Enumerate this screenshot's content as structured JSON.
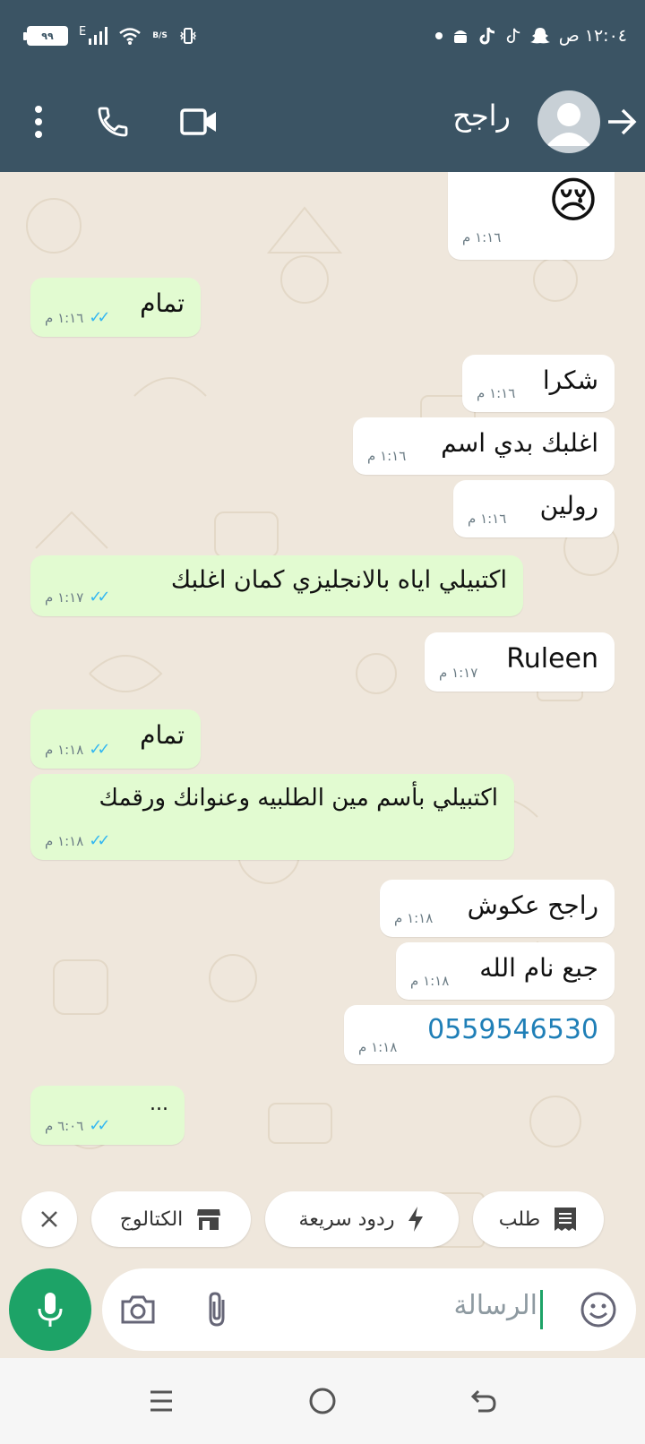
{
  "status": {
    "time": "١٢:٠٤ ص",
    "battery": "٩٩",
    "network": "E",
    "speed": "B/S"
  },
  "header": {
    "contact_name": "راجح"
  },
  "messages": [
    {
      "dir": "in",
      "text": "😢",
      "time": "١:١٦ م"
    },
    {
      "dir": "out",
      "text": "تمام",
      "time": "١:١٦ م"
    },
    {
      "dir": "in",
      "text": "شكرا",
      "time": "١:١٦ م"
    },
    {
      "dir": "in",
      "text": "اغلبك بدي اسم",
      "time": "١:١٦ م"
    },
    {
      "dir": "in",
      "text": "رولين",
      "time": "١:١٦ م"
    },
    {
      "dir": "out",
      "text": "اكتبيلي اياه بالانجليزي كمان اغلبك",
      "time": "١:١٧ م"
    },
    {
      "dir": "in",
      "text": "Ruleen",
      "time": "١:١٧ م"
    },
    {
      "dir": "out",
      "text": "تمام",
      "time": "١:١٨ م"
    },
    {
      "dir": "out",
      "text": "اكتبيلي بأسم مين الطلبيه وعنوانك ورقمك",
      "time": "١:١٨ م"
    },
    {
      "dir": "in",
      "text": "راجح عكوش",
      "time": "١:١٨ م"
    },
    {
      "dir": "in",
      "text": "جبع نام الله",
      "time": "١:١٨ م"
    },
    {
      "dir": "in",
      "text": "0559546530",
      "time": "١:١٨ م"
    },
    {
      "dir": "out",
      "text": "...",
      "time": "٦:٠٦ م"
    }
  ],
  "chips": {
    "order": "طلب",
    "quick_replies": "ردود سريعة",
    "catalog": "الكتالوج"
  },
  "composer": {
    "placeholder": "الرسالة"
  },
  "colors": {
    "header": "#3b5464",
    "outgoing": "#e2fbd1",
    "incoming": "#ffffff",
    "accent": "#1da367",
    "ticks": "#34b7f1"
  },
  "icons": [
    "back-arrow-icon",
    "avatar-icon",
    "video-call-icon",
    "voice-call-icon",
    "more-options-icon",
    "close-icon",
    "store-icon",
    "lightning-icon",
    "receipt-icon",
    "mic-icon",
    "camera-icon",
    "attach-icon",
    "emoji-icon",
    "recents-icon",
    "home-icon",
    "back-nav-icon"
  ]
}
